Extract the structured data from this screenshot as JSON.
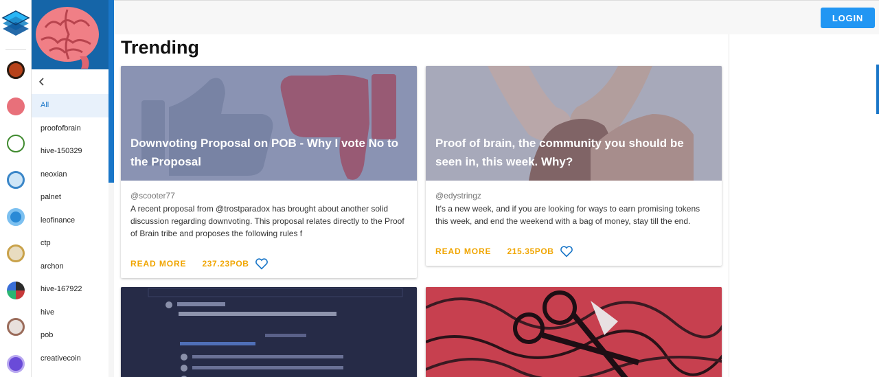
{
  "header": {
    "login_label": "LOGIN"
  },
  "page": {
    "title": "Trending"
  },
  "sidebar": {
    "items": [
      {
        "label": "All",
        "active": true
      },
      {
        "label": "proofofbrain"
      },
      {
        "label": "hive-150329"
      },
      {
        "label": "neoxian"
      },
      {
        "label": "palnet"
      },
      {
        "label": "leofinance"
      },
      {
        "label": "ctp"
      },
      {
        "label": "archon"
      },
      {
        "label": "hive-167922"
      },
      {
        "label": "hive"
      },
      {
        "label": "pob"
      },
      {
        "label": "creativecoin"
      }
    ]
  },
  "rail_icons": [
    {
      "icon": "lion-community-icon",
      "color": "#b8421a"
    },
    {
      "icon": "brain-community-icon",
      "color": "#e8707a"
    },
    {
      "icon": "cannabis-community-icon",
      "color": "#3f8a2e"
    },
    {
      "icon": "robot-community-icon",
      "color": "#3a86c8"
    },
    {
      "icon": "leo-community-icon",
      "color": "#2a8ad6"
    },
    {
      "icon": "ctp-community-icon",
      "color": "#c9a24a"
    },
    {
      "icon": "archon-community-icon",
      "color": "#2b2b2b"
    },
    {
      "icon": "hive-dragon-community-icon",
      "color": "#9a6b5a"
    },
    {
      "icon": "creativecoin-community-icon",
      "color": "#6a4bd8"
    }
  ],
  "posts": [
    {
      "title": "Downvoting Proposal on POB - Why I vote No to the Proposal",
      "author": "@scooter77",
      "excerpt": "A recent proposal from @trostparadox has brought about another solid discussion regarding downvoting. This proposal relates directly to the Proof of Brain tribe and proposes the following rules f",
      "read_more": "READ MORE",
      "payout": "237.23POB"
    },
    {
      "title": "Proof of brain, the community you should be seen in, this week. Why?",
      "author": "@edystringz",
      "excerpt": "It's a new week, and if you are looking for ways to earn promising tokens this week, and end the weekend with a bag of money, stay till the end.",
      "read_more": "READ MORE",
      "payout": "215.35POB"
    }
  ],
  "colors": {
    "accent": "#1976c8",
    "login": "#2196f3",
    "payout": "#f0a500"
  }
}
